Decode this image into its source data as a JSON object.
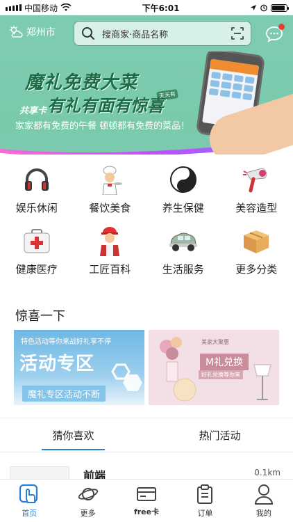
{
  "status_bar": {
    "carrier": "中国移动",
    "time": "下午6:01",
    "battery_level": 0.9
  },
  "header": {
    "city": "郑州市",
    "search_placeholder": "搜商家·商品名称",
    "weather_icon": "weather-cloud-sun-icon",
    "scan_icon": "scan-icon",
    "message_icon": "message-icon"
  },
  "banner": {
    "line1": "魔礼免费大菜",
    "line2": "有礼有面有惊喜",
    "badge": "共享卡",
    "small_tag": "天天有",
    "subtitle": "家家都有免费的午餐  顿顿都有免费的菜品！"
  },
  "categories": [
    {
      "label": "娱乐休闲",
      "icon": "headphones-icon"
    },
    {
      "label": "餐饮美食",
      "icon": "chef-icon"
    },
    {
      "label": "养生保健",
      "icon": "yin-yang-icon"
    },
    {
      "label": "美容造型",
      "icon": "hair-dryer-icon"
    },
    {
      "label": "健康医疗",
      "icon": "first-aid-kit-icon"
    },
    {
      "label": "工匠百科",
      "icon": "craftsman-icon"
    },
    {
      "label": "生活服务",
      "icon": "car-icon"
    },
    {
      "label": "更多分类",
      "icon": "box-icon"
    }
  ],
  "surprise": {
    "title": "惊喜一下",
    "promo_left": {
      "small": "特色活动等你来战好礼享不停",
      "big": "活动专区",
      "sub": "魔礼专区活动不断"
    },
    "promo_right": {
      "small": "美家大聚惠",
      "big": "M礼兑换",
      "sub": "好礼兑换等你来"
    }
  },
  "tabs": [
    "猜你喜欢",
    "热门活动"
  ],
  "list_peek": {
    "name": "前端",
    "distance": "0.1km"
  },
  "bottom_nav": [
    {
      "label": "首页",
      "icon": "home-hand-icon",
      "active": true
    },
    {
      "label": "更多",
      "icon": "planet-icon",
      "active": false
    },
    {
      "label": "free卡",
      "icon": "card-icon",
      "active": false
    },
    {
      "label": "订单",
      "icon": "clipboard-icon",
      "active": false
    },
    {
      "label": "我的",
      "icon": "user-icon",
      "active": false
    }
  ],
  "colors": {
    "header_bg": "#7dccb0",
    "accent": "#2a7fd4",
    "badge": "#e83b3b"
  }
}
